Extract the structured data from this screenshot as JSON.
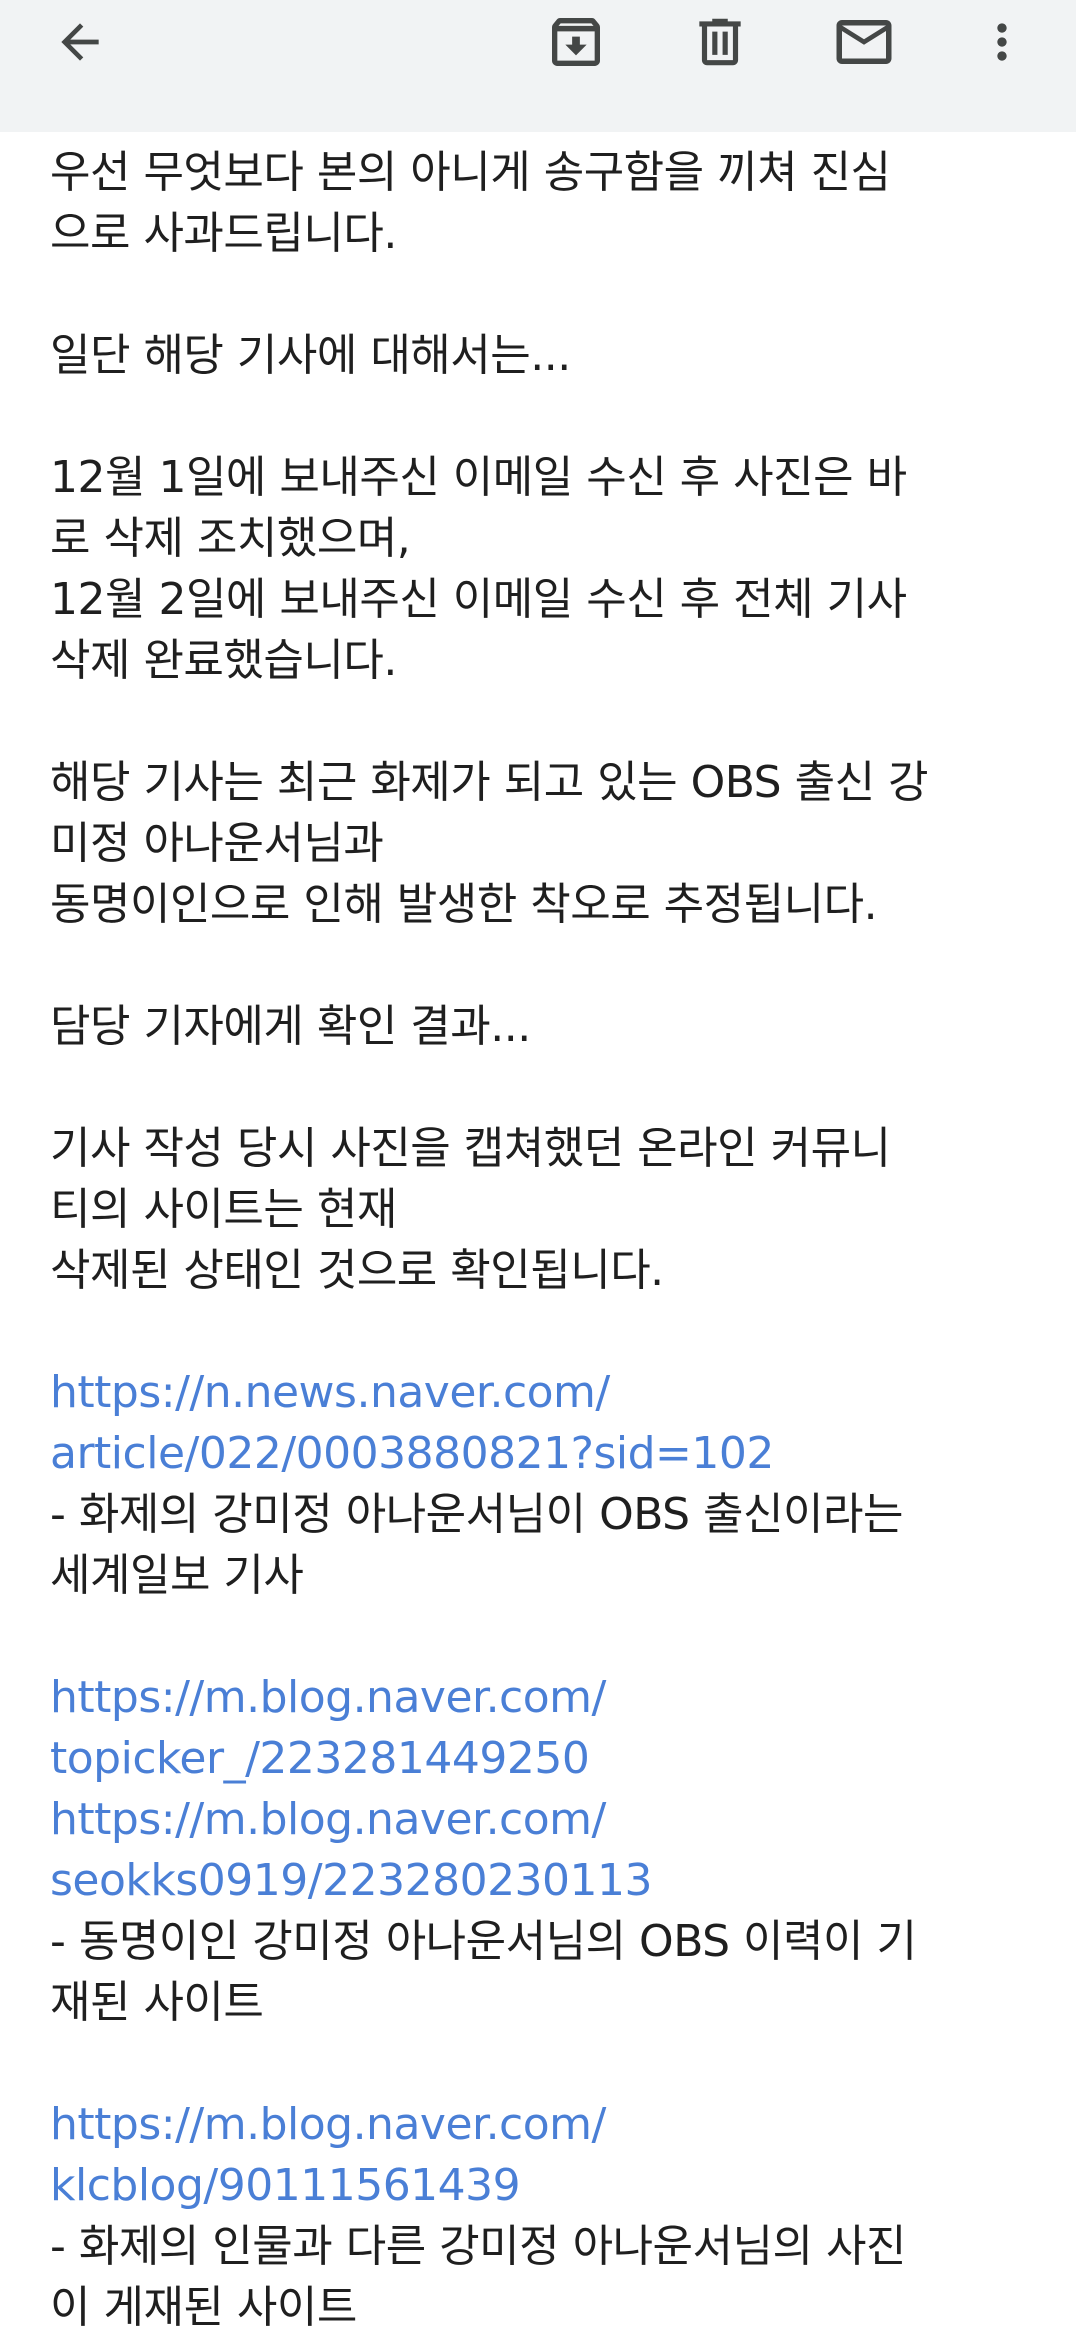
{
  "toolbar": {
    "back_icon": "arrow-left-icon",
    "archive_icon": "archive-icon",
    "delete_icon": "trash-icon",
    "mark_unread_icon": "mail-icon",
    "more_icon": "more-vertical-icon"
  },
  "message": {
    "p1": [
      "우선 무엇보다 본의 아니게 송구함을 끼쳐 진심",
      "으로 사과드립니다."
    ],
    "p2": [
      "일단 해당 기사에 대해서는..."
    ],
    "p3": [
      "12월 1일에 보내주신 이메일 수신 후 사진은 바",
      "로 삭제 조치했으며,",
      "12월 2일에 보내주신 이메일 수신 후 전체 기사",
      "삭제 완료했습니다."
    ],
    "p4": [
      "해당 기사는 최근 화제가 되고 있는 OBS 출신 강",
      "미정 아나운서님과",
      "동명이인으로 인해 발생한 착오로 추정됩니다."
    ],
    "p5": [
      "담당 기자에게 확인 결과..."
    ],
    "p6": [
      "기사 작성 당시 사진을 캡쳐했던 온라인 커뮤니",
      "티의 사이트는 현재",
      "삭제된 상태인 것으로 확인됩니다."
    ],
    "link1": [
      "https://n.news.naver.com/",
      "article/022/0003880821?sid=102"
    ],
    "desc1": [
      "- 화제의 강미정 아나운서님이 OBS 출신이라는",
      "세계일보 기사"
    ],
    "link2": [
      "https://m.blog.naver.com/",
      "topicker_/223281449250"
    ],
    "link3": [
      "https://m.blog.naver.com/",
      "seokks0919/223280230113"
    ],
    "desc2": [
      "- 동명이인 강미정 아나운서님의 OBS 이력이 기",
      "재된 사이트"
    ],
    "link4": [
      "https://m.blog.naver.com/",
      "klcblog/90111561439"
    ],
    "desc3": [
      "- 화제의 인물과 다른 강미정 아나운서님의 사진",
      "이 게재된 사이트"
    ]
  },
  "colors": {
    "toolbar_bg": "#f1f3f4",
    "text": "#1f1f1f",
    "link": "#4a7fd6",
    "icon": "#444746"
  }
}
